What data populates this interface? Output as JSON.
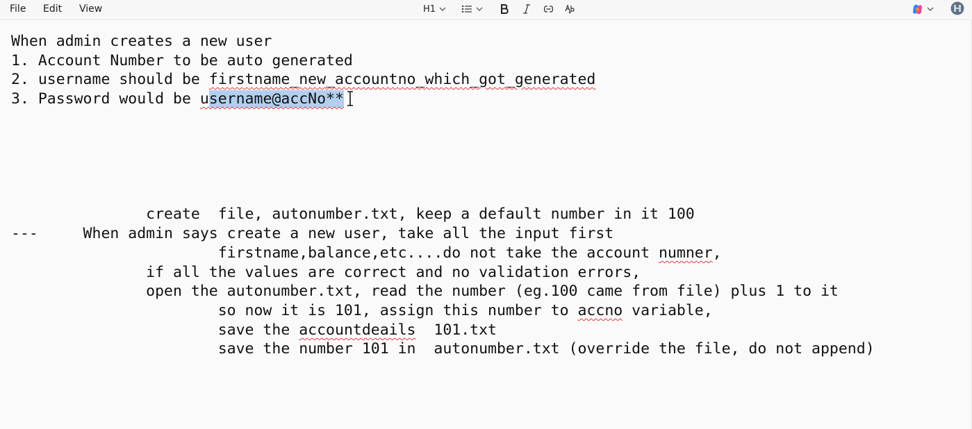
{
  "menu": {
    "file": "File",
    "edit": "Edit",
    "view": "View"
  },
  "toolbar": {
    "heading": "H1"
  },
  "doc": {
    "line1": "When admin creates a new user",
    "line2": "1. Account Number to be auto generated",
    "line3_prefix": "2. username should be ",
    "line3_word": "firstname_new_accountno_which_got_generated",
    "line4_prefix": "3. Password would be ",
    "line4_u": "u",
    "line4_selected": "sername@accNo**",
    "l5": "               create  file, autonumber.txt, keep a default number in it 100",
    "l6": "---     When admin says create a new user, take all the input first",
    "l7_prefix": "                       firstname,balance,etc....do not take the account ",
    "l7_word": "numner",
    "l7_suffix": ",",
    "l8": "               if all the values are correct and no validation errors,",
    "l9": "               open the autonumber.txt, read the number (eg.100 came from file) plus 1 to it",
    "l10_prefix": "                       so now it is 101, assign this number to ",
    "l10_word": "accno",
    "l10_suffix": " variable,",
    "l11_prefix": "                       save the ",
    "l11_word": "accountdeails",
    "l11_suffix": "  101.txt",
    "l12": "                       save the number 101 in  autonumber.txt (override the file, do not append)"
  }
}
